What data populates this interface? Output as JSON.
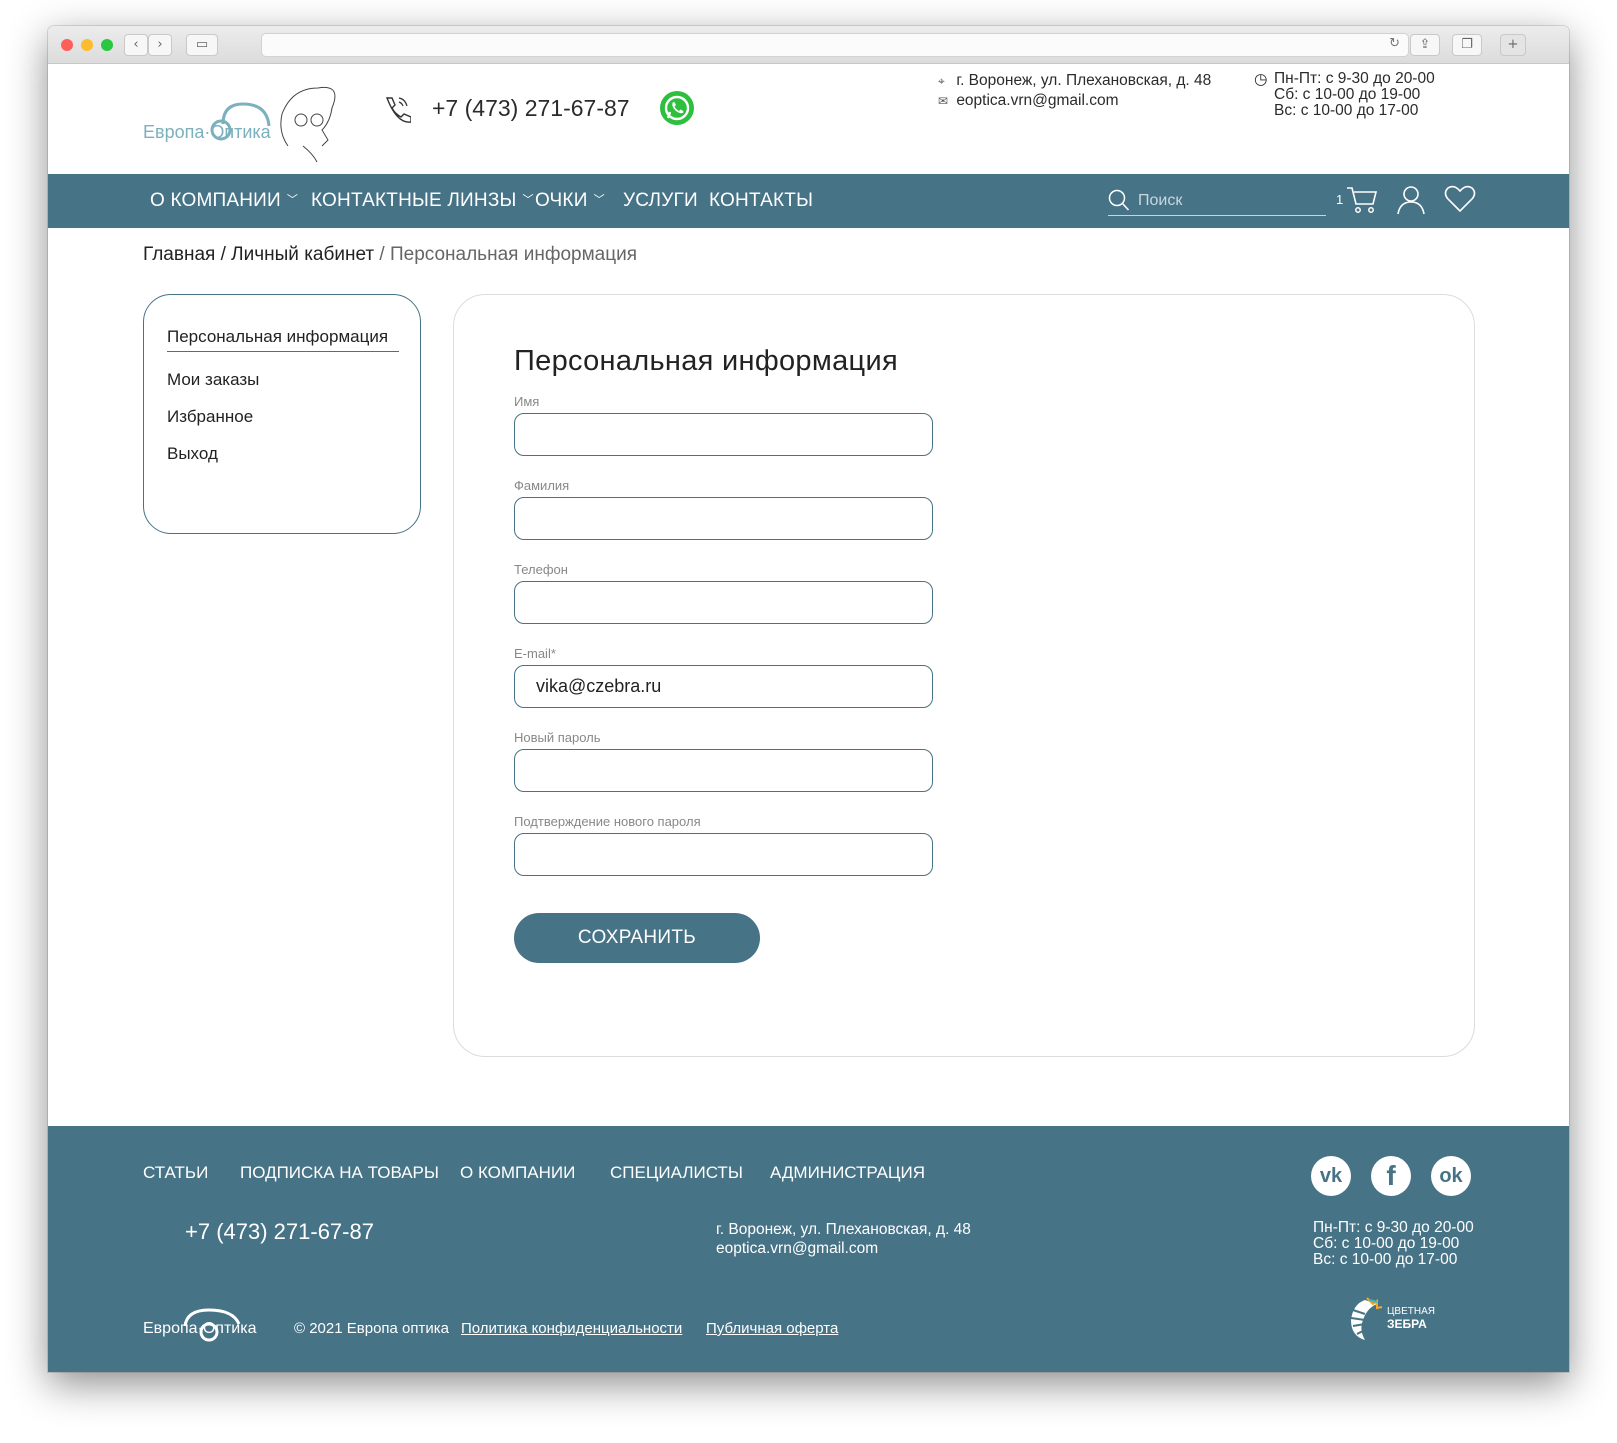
{
  "header": {
    "logo_text": "Европа·Оптика",
    "phone": "+7 (473) 271-67-87",
    "address": "г. Воронеж, ул. Плехановская, д. 48",
    "email": "eoptica.vrn@gmail.com",
    "hours": [
      "Пн-Пт: с 9-30 до 20-00",
      "Сб: с 10-00 до 19-00",
      "Вс: с 10-00 до 17-00"
    ]
  },
  "nav": {
    "items": [
      "О КОМПАНИИ",
      "КОНТАКТНЫЕ ЛИНЗЫ",
      "ОЧКИ",
      "УСЛУГИ",
      "КОНТАКТЫ"
    ],
    "search_placeholder": "Поиск",
    "cart_count": "1"
  },
  "breadcrumb": {
    "home": "Главная",
    "sep1": " / ",
    "cabinet": "Личный кабинет",
    "sep2": " / ",
    "current": "Персональная информация"
  },
  "sidebar": {
    "items": [
      "Персональная информация",
      "Мои заказы",
      "Избранное",
      "Выход"
    ]
  },
  "form": {
    "title": "Персональная информация",
    "fields": [
      {
        "label": "Имя",
        "value": ""
      },
      {
        "label": "Фамилия",
        "value": ""
      },
      {
        "label": "Телефон",
        "value": ""
      },
      {
        "label": "E-mail*",
        "value": "vika@czebra.ru"
      },
      {
        "label": "Новый пароль",
        "value": ""
      },
      {
        "label": "Подтверждение нового пароля",
        "value": ""
      }
    ],
    "save_label": "СОХРАНИТЬ"
  },
  "footer": {
    "nav": [
      "СТАТЬИ",
      "ПОДПИСКА НА ТОВАРЫ",
      "О КОМПАНИИ",
      "СПЕЦИАЛИСТЫ",
      "АДМИНИСТРАЦИЯ"
    ],
    "phone": "+7 (473) 271-67-87",
    "address": "г. Воронеж, ул. Плехановская, д. 48",
    "email": "eoptica.vrn@gmail.com",
    "hours": [
      "Пн-Пт: с 9-30 до 20-00",
      "Сб: с 10-00 до 19-00",
      "Вс: с 10-00 до 17-00"
    ],
    "logo_text": "Европа·Оптика",
    "copyright": "© 2021 Европа оптика",
    "privacy_link": "Политика конфиденциальности",
    "offer_link": "Публичная оферта",
    "social": [
      "vk-icon",
      "facebook-icon",
      "odnoklassniki-icon"
    ],
    "dev_brand_small": "ЦВЕТНАЯ",
    "dev_brand_big": "ЗЕБРА"
  },
  "colors": {
    "brand": "#477386",
    "logo_accent": "#7bb0bd",
    "whatsapp": "#2fbf3e"
  }
}
